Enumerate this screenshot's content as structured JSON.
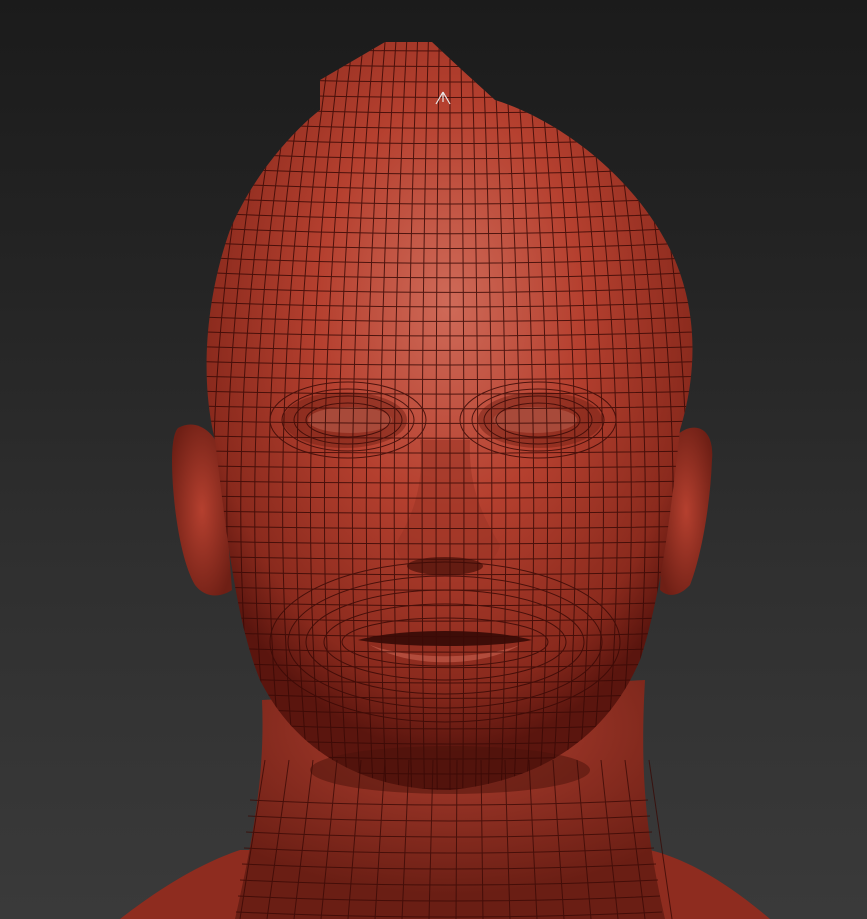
{
  "viewport": {
    "background_top": "#1b1b1b",
    "background_bottom": "#3a3a3a"
  },
  "model": {
    "material_color": "#b5402f",
    "highlight_color": "#d0705f",
    "shadow_color": "#5a150e",
    "wire_color": "#3a0a06",
    "wireframe_visible": true
  },
  "cursor": {
    "icon": "arrow-cursor-icon"
  }
}
